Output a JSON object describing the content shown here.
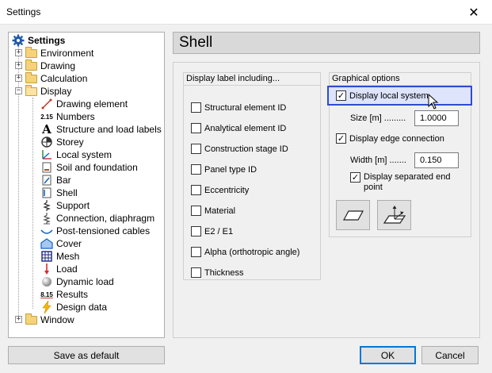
{
  "window": {
    "title": "Settings",
    "close_symbol": "✕"
  },
  "tree": {
    "root": "Settings",
    "level1": [
      {
        "label": "Environment",
        "expander": "+"
      },
      {
        "label": "Drawing",
        "expander": "+"
      },
      {
        "label": "Calculation",
        "expander": "+"
      },
      {
        "label": "Display",
        "expander": "−"
      }
    ],
    "display_children": [
      {
        "label": "Drawing element",
        "icon": "drawing-element-icon"
      },
      {
        "label": "Numbers",
        "icon": "numbers-icon",
        "glyph": "2.15"
      },
      {
        "label": "Structure and load labels",
        "icon": "labels-icon",
        "glyph": "A"
      },
      {
        "label": "Storey",
        "icon": "storey-icon"
      },
      {
        "label": "Local system",
        "icon": "local-system-icon"
      },
      {
        "label": "Soil and foundation",
        "icon": "soil-icon"
      },
      {
        "label": "Bar",
        "icon": "bar-icon"
      },
      {
        "label": "Shell",
        "icon": "shell-icon"
      },
      {
        "label": "Support",
        "icon": "support-icon"
      },
      {
        "label": "Connection, diaphragm",
        "icon": "connection-icon"
      },
      {
        "label": "Post-tensioned cables",
        "icon": "cable-icon"
      },
      {
        "label": "Cover",
        "icon": "cover-icon"
      },
      {
        "label": "Mesh",
        "icon": "mesh-icon"
      },
      {
        "label": "Load",
        "icon": "load-icon"
      },
      {
        "label": "Dynamic load",
        "icon": "dynamic-load-icon"
      },
      {
        "label": "Results",
        "icon": "results-icon",
        "glyph": "8.15"
      },
      {
        "label": "Design data",
        "icon": "design-data-icon"
      }
    ],
    "last": {
      "label": "Window",
      "expander": "+"
    }
  },
  "page": {
    "title": "Shell"
  },
  "display_label": {
    "header": "Display label including...",
    "items": [
      {
        "label": "Structural element ID",
        "checked": false
      },
      {
        "label": "Analytical element ID",
        "checked": false
      },
      {
        "label": "Construction stage ID",
        "checked": false
      },
      {
        "label": "Panel type ID",
        "checked": false
      },
      {
        "label": "Eccentricity",
        "checked": false
      },
      {
        "label": "Material",
        "checked": false
      },
      {
        "label": "E2 / E1",
        "checked": false
      },
      {
        "label": "Alpha (orthotropic angle)",
        "checked": false
      },
      {
        "label": "Thickness",
        "checked": false
      }
    ]
  },
  "graphical": {
    "header": "Graphical options",
    "display_local_system": "Display local system",
    "size_label": "Size [m] .........",
    "size_value": "1.0000",
    "display_edge_connection": "Display edge connection",
    "width_label": "Width [m] .......",
    "width_value": "0.150",
    "display_separated_end_line1": "Display separated end",
    "display_separated_end_line2": "point",
    "check_mark": "✓"
  },
  "footer": {
    "save_default": "Save as default",
    "ok": "OK",
    "cancel": "Cancel"
  },
  "colors": {
    "highlight_border": "#2f4bd0",
    "highlight_fill": "#dde4fb",
    "ok_border": "#0078d7"
  }
}
